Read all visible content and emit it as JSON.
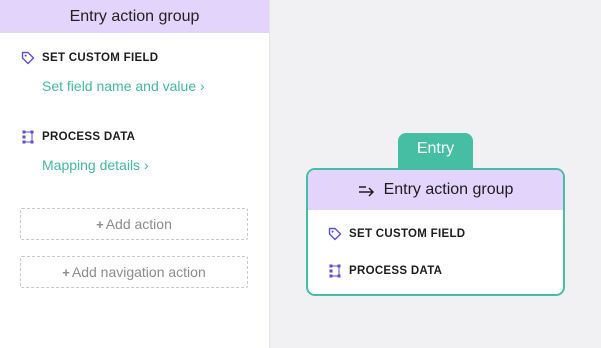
{
  "sidebar": {
    "header": "Entry action group",
    "actions": [
      {
        "title": "SET CUSTOM FIELD",
        "link": "Set field name and value",
        "icon": "tag-icon"
      },
      {
        "title": "PROCESS DATA",
        "link": "Mapping details",
        "icon": "process-data-icon"
      }
    ],
    "add_action": "Add action",
    "add_navigation_action": "Add navigation action"
  },
  "canvas": {
    "tab_label": "Entry",
    "node_title": "Entry action group",
    "node_rows": [
      {
        "title": "SET CUSTOM FIELD",
        "icon": "tag-icon"
      },
      {
        "title": "PROCESS DATA",
        "icon": "process-data-icon"
      }
    ]
  },
  "colors": {
    "accent": "#45bea4",
    "link": "#41b9a1",
    "header_bg": "#e3d4fb",
    "icon": "#5b4fd6"
  }
}
